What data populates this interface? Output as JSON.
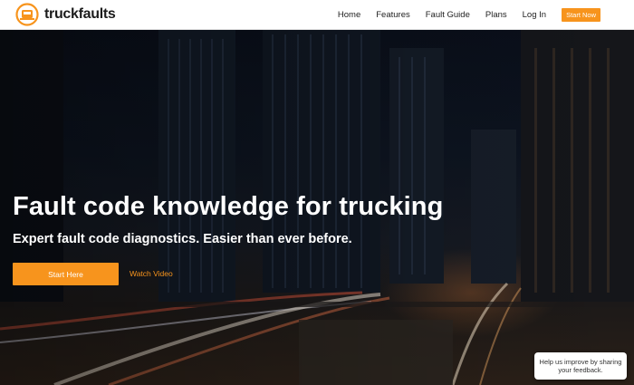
{
  "brand": {
    "name_prefix": "truck",
    "name_suffix": "faults",
    "accent_color": "#f7941d",
    "logo_icon": "truck-badge-icon"
  },
  "nav": {
    "items": [
      {
        "label": "Home"
      },
      {
        "label": "Features"
      },
      {
        "label": "Fault Guide"
      },
      {
        "label": "Plans"
      },
      {
        "label": "Log In"
      }
    ],
    "cta_label": "Start Now"
  },
  "hero": {
    "headline": "Fault code knowledge for trucking",
    "subheadline": "Expert fault code diagnostics. Easier than ever before.",
    "primary_button": "Start Here",
    "secondary_link": "Watch Video"
  },
  "feedback": {
    "text": "Help us improve by sharing your feedback."
  }
}
